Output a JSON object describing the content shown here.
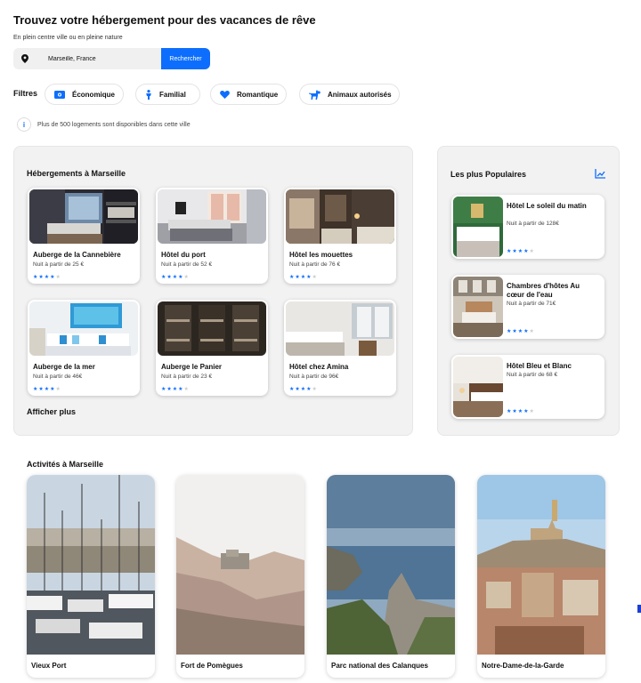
{
  "header": {
    "title": "Trouvez votre hébergement pour des vacances de rêve",
    "subtitle": "En plein centre ville ou en pleine nature"
  },
  "search": {
    "value": "Marseille, France",
    "button_label": "Rechercher",
    "icon": "location-pin-icon"
  },
  "filters": {
    "label": "Filtres",
    "items": [
      {
        "label": "Économique",
        "icon": "money-icon"
      },
      {
        "label": "Familial",
        "icon": "person-icon"
      },
      {
        "label": "Romantique",
        "icon": "heart-icon"
      },
      {
        "label": "Animaux autorisés",
        "icon": "dog-icon"
      }
    ]
  },
  "info": {
    "text": "Plus de 500 logements sont disponibles dans cette ville",
    "icon": "info-icon"
  },
  "hebergements": {
    "title": "Hébergements à Marseille",
    "show_more": "Afficher plus",
    "cards": [
      {
        "name": "Auberge de la Cannebière",
        "price": "Nuit à partir de 25 €",
        "rating": 4
      },
      {
        "name": "Hôtel du port",
        "price": "Nuit à partir de 52 €",
        "rating": 4
      },
      {
        "name": "Hôtel les mouettes",
        "price": "Nuit à partir de 76 €",
        "rating": 4
      },
      {
        "name": "Auberge de la mer",
        "price": "Nuit à partir de 46€",
        "rating": 4
      },
      {
        "name": "Auberge le Panier",
        "price": "Nuit à partir de 23 €",
        "rating": 4
      },
      {
        "name": "Hôtel chez Amina",
        "price": "Nuit à partir de 96€",
        "rating": 4
      }
    ]
  },
  "populaires": {
    "title": "Les plus Populaires",
    "icon": "trending-chart-icon",
    "cards": [
      {
        "name": "Hôtel Le soleil du matin",
        "price": "Nuit à partir de 128€",
        "rating": 4
      },
      {
        "name": "Chambres d'hôtes Au cœur de l'eau",
        "price": "Nuit à partir de 71€",
        "rating": 4
      },
      {
        "name": "Hôtel Bleu et Blanc",
        "price": "Nuit à partir de 68 €",
        "rating": 4
      }
    ]
  },
  "activites": {
    "title": "Activités à Marseille",
    "cards": [
      {
        "name": "Vieux Port"
      },
      {
        "name": "Fort de Pomègues"
      },
      {
        "name": "Parc national des Calanques"
      },
      {
        "name": "Notre-Dame-de-la-Garde"
      }
    ]
  },
  "colors": {
    "accent": "#0d6efd",
    "panel_bg": "#f2f2f2",
    "star_off": "#cccccc"
  }
}
